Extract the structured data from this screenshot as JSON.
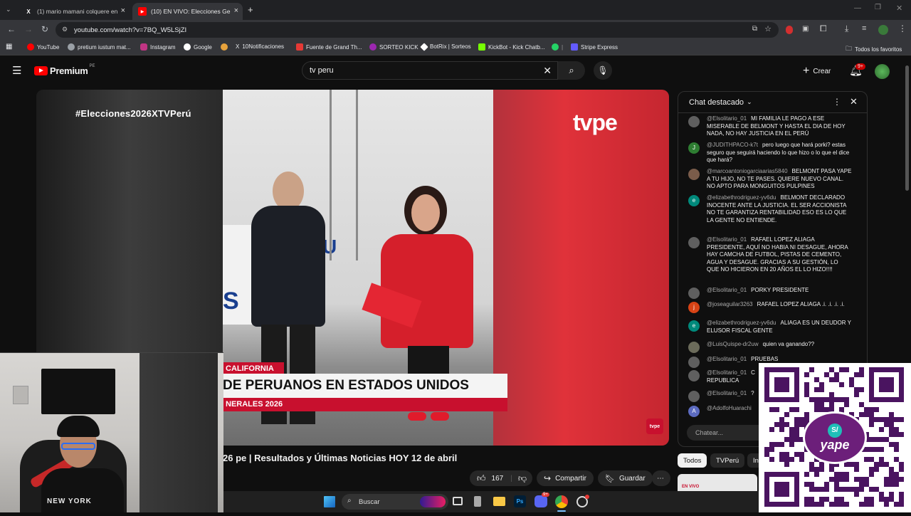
{
  "browser": {
    "tabs": [
      {
        "label": "(1) mario mamani colquere en",
        "icon": "x-logo-icon"
      },
      {
        "label": "(10) EN VIVO: Elecciones Ge",
        "icon": "youtube-icon"
      }
    ],
    "url": "youtube.com/watch?v=7BQ_W5LSjZI",
    "bookmarks": [
      "YouTube",
      "pretium iustum mat...",
      "Instagram",
      "Google",
      "10Notificaciones",
      "Fuente de Grand Th...",
      "SORTEO KICK",
      "BotRix | Sorteos",
      "KickBot - Kick Chatb...",
      "Stripe Express"
    ],
    "all_bookmarks": "Todos los favoritos"
  },
  "youtube": {
    "logo": "Premium",
    "logo_region": "PE",
    "search_value": "tv peru",
    "create_label": "Crear",
    "notif_badge": "9+"
  },
  "video": {
    "hashtag": "#Elecciones2026XTVPerú",
    "channel_logo": "tvpe",
    "lower_third_top": "CALIFORNIA",
    "lower_third_main": "DE PERUANOS EN ESTADOS UNIDOS",
    "lower_third_sub": "NERALES 2026",
    "corner_logo": "tvpe",
    "title": "26 pe | Resultados y Últimas Noticias HOY 12 de abril",
    "likes": "167",
    "share_label": "Compartir",
    "save_label": "Guardar"
  },
  "chat": {
    "title": "Chat destacado",
    "placeholder": "Chatear...",
    "messages": [
      {
        "user": "@Elsolitario_01",
        "text": "MI FAMILIA LE PAGO A ESE MISERABLE DE BELMONT Y HASTA EL DIA DE HOY NADA, NO HAY JUSTICIA EN EL PERÚ",
        "avatar": "",
        "color": "#5f5f5f"
      },
      {
        "user": "@JUDITHPACO-k7t",
        "text": "pero luego que hará porki? estas seguro que seguirá haciendo lo que hizo o lo que el dice que hará?",
        "avatar": "J",
        "color": "#2e7d32"
      },
      {
        "user": "@marcoantoniogarciaarias5840",
        "text": "BELMONT PASA YAPE A TU HIJO, NO TE PASES. QUIERE NUEVO CANAL. NO APTO PARA MONGUITOS PULPINES",
        "avatar": "",
        "color": "#7a5c4a"
      },
      {
        "user": "@elizabethrodriguez-yv6du",
        "text": "BELMONT DECLARADO INOCENTE ANTE LA JUSTICIA. EL SER ACCIONISTA NO TE GARANTIZA RENTABILIDAD ESO ES LO QUE LA GENTE NO ENTIENDE.",
        "avatar": "e",
        "color": "#00897b"
      },
      {
        "user": "@Elsolitario_01",
        "text": "RAFAEL LOPEZ ALIAGA PRESIDENTE, AQUÍ NO HABIA NI DESAGUE, AHORA HAY CAMCHA DE FUTBOL, PISTAS DE CEMENTO, AGUA Y DESAGUE. GRACIAS A SU GESTIÓN, LO QUE NO HICIERON EN 20 AÑOS EL LO HIZO!!!!",
        "avatar": "",
        "color": "#5f5f5f"
      },
      {
        "user": "@Elsolitario_01",
        "text": "PORKY PRESIDENTE",
        "avatar": "",
        "color": "#5f5f5f"
      },
      {
        "user": "@joseaguilar3263",
        "text": "RAFAEL LOPEZ ALIAGA .i. .i. .i. .i.",
        "avatar": "j",
        "color": "#d84315"
      },
      {
        "user": "@elizabethrodriguez-yv6du",
        "text": "ALIAGA ES UN DEUDOR Y ELUSOR FISCAL GENTE",
        "avatar": "e",
        "color": "#00897b"
      },
      {
        "user": "@LuisQuispe-dr2uw",
        "text": "quien va ganando??",
        "avatar": "",
        "color": "#6b6b5a"
      },
      {
        "user": "@Elsolitario_01",
        "text": "PRUEBAS",
        "avatar": "",
        "color": "#5f5f5f"
      },
      {
        "user": "@Elsolitario_01",
        "text": "C",
        "avatar": "",
        "color": "#5f5f5f",
        "extra": "REPUBLICA"
      },
      {
        "user": "@Elsolitario_01",
        "text": "?",
        "avatar": "",
        "color": "#5f5f5f"
      },
      {
        "user": "@AdolfoHuarachi",
        "text": "",
        "avatar": "A",
        "color": "#5c6bc0"
      }
    ]
  },
  "chips": [
    "Todos",
    "TVPerú",
    "In"
  ],
  "related": {
    "badge": "EN VIVO"
  },
  "webcam": {
    "shirt_text": "NEW YORK"
  },
  "taskbar": {
    "search": "Buscar",
    "discord_badge": "9+"
  },
  "qr": {
    "brand": "yape",
    "symbol": "S/"
  }
}
